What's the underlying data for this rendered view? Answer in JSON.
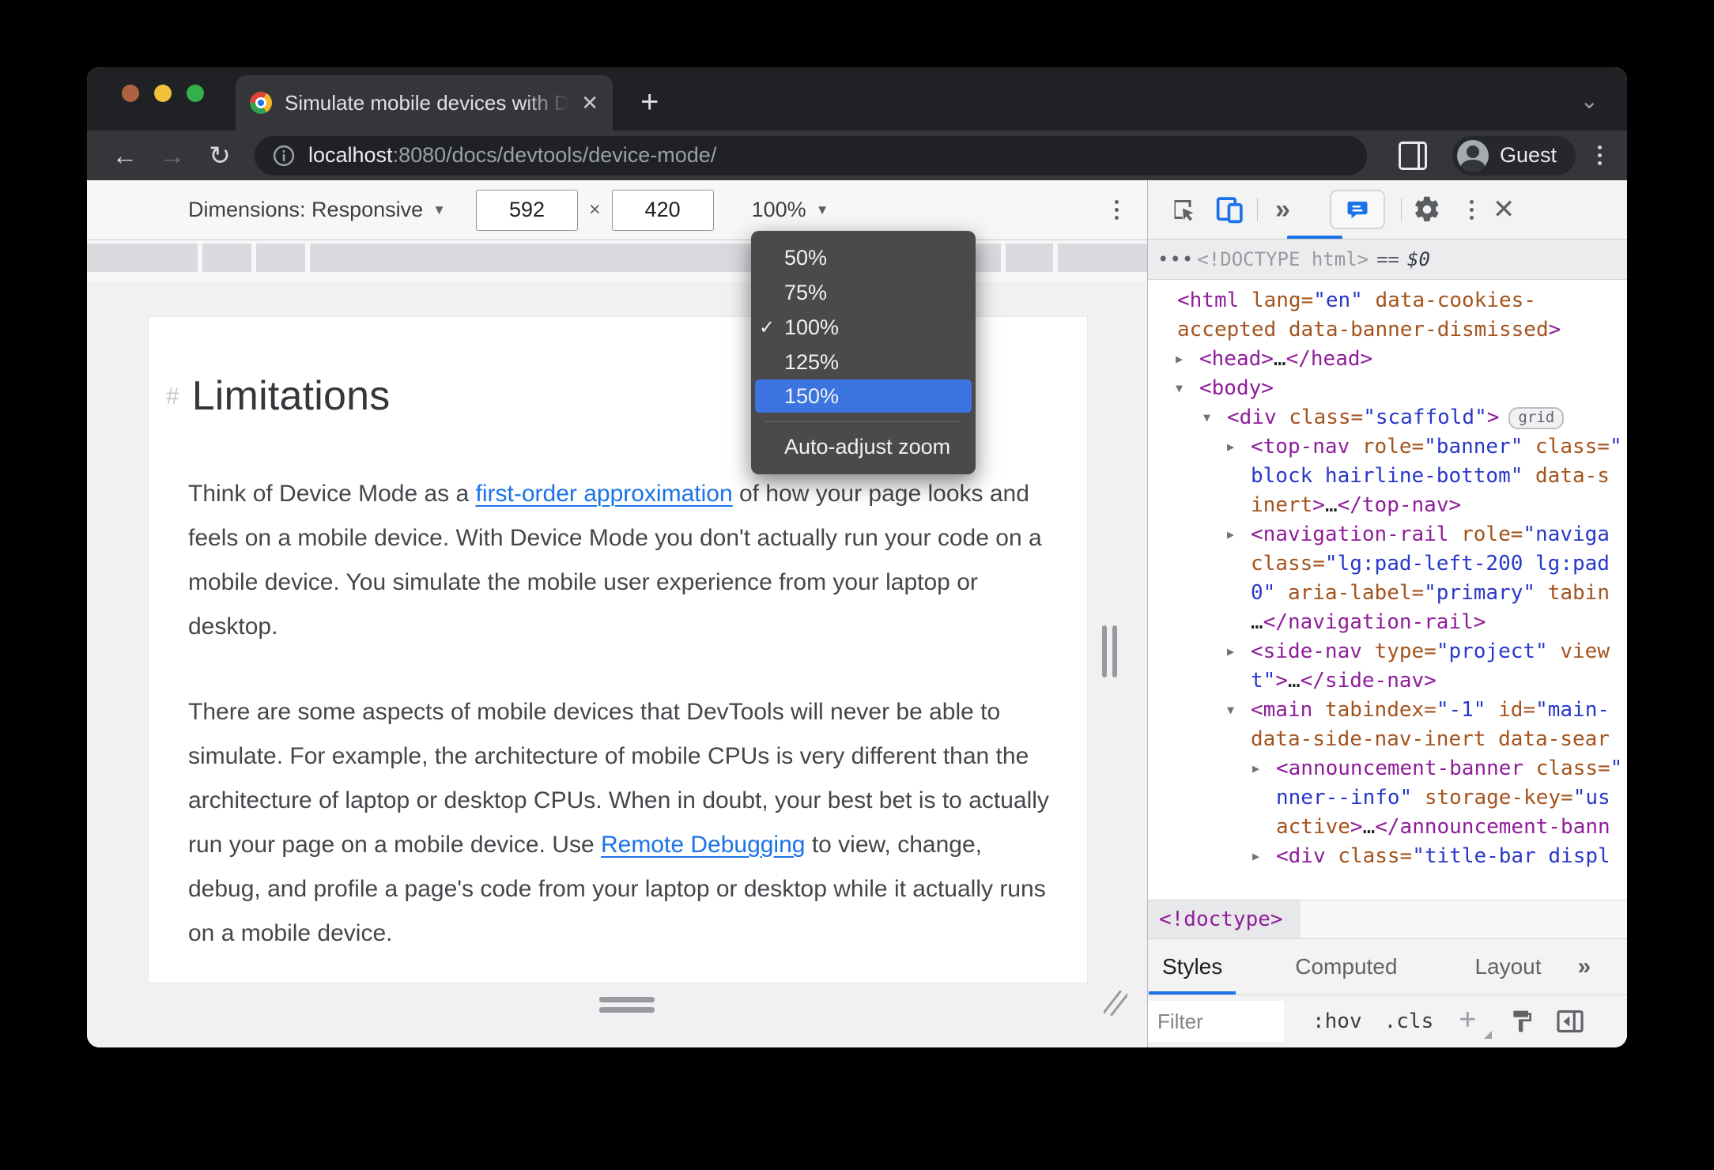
{
  "browser": {
    "tab_title": "Simulate mobile devices with D",
    "new_tab": "+",
    "tab_close": "✕",
    "tab_search_chevron": "⌄",
    "back": "←",
    "forward": "→",
    "reload": "↻",
    "url_host": "localhost",
    "url_path": ":8080/docs/devtools/device-mode/",
    "profile_label": "Guest"
  },
  "device_toolbar": {
    "dimensions_label": "Dimensions: Responsive",
    "caret": "▾",
    "width_value": "592",
    "times": "×",
    "height_value": "420",
    "zoom_value": "100%"
  },
  "zoom_menu": {
    "items": [
      {
        "label": "50%",
        "checked": false,
        "highlighted": false
      },
      {
        "label": "75%",
        "checked": false,
        "highlighted": false
      },
      {
        "label": "100%",
        "checked": true,
        "highlighted": false
      },
      {
        "label": "125%",
        "checked": false,
        "highlighted": false
      },
      {
        "label": "150%",
        "checked": false,
        "highlighted": true
      }
    ],
    "checkmark": "✓",
    "footer": "Auto-adjust zoom",
    "highlight_color": "#3b74e0"
  },
  "page": {
    "heading_hash": "#",
    "heading": "Limitations",
    "p1_before": "Think of Device Mode as a ",
    "p1_link": "first-order approximation",
    "p1_after": " of how your page looks and feels on a mobile device. With Device Mode you don't actually run your code on a mobile device. You simulate the mobile user experience from your laptop or desktop.",
    "p2_before": "There are some aspects of mobile devices that DevTools will never be able to simulate. For example, the architecture of mobile CPUs is very different than the architecture of laptop or desktop CPUs. When in doubt, your best bet is to actually run your page on a mobile device. Use ",
    "p2_link": "Remote Debugging",
    "p2_after": " to view, change, debug, and profile a page's code from your laptop or desktop while it actually runs on a mobile device.",
    "link_color": "#1a73e8"
  },
  "devtools": {
    "more_tabs": "»",
    "close": "✕",
    "breadcrumb": {
      "dots": "•••",
      "node": "<!DOCTYPE html>",
      "eq": "==",
      "dollar": "$0"
    },
    "tree": {
      "lines": [
        {
          "i": 37,
          "s": [
            [
              "tag",
              "<html"
            ],
            [
              "attr",
              " lang="
            ],
            [
              "val",
              "\"en\""
            ],
            [
              "attr",
              " data-cookies-"
            ]
          ]
        },
        {
          "i": 37,
          "s": [
            [
              "attr",
              "accepted data-banner-dismissed"
            ],
            [
              "tag",
              ">"
            ]
          ]
        },
        {
          "i": 65,
          "a": "c",
          "s": [
            [
              "tag",
              "<head>"
            ],
            [
              "plain",
              "…"
            ],
            [
              "tag",
              "</head>"
            ]
          ]
        },
        {
          "i": 65,
          "a": "o",
          "s": [
            [
              "tag",
              "<body>"
            ]
          ]
        },
        {
          "i": 100,
          "a": "o",
          "s": [
            [
              "tag",
              "<div"
            ],
            [
              "attr",
              " class="
            ],
            [
              "val",
              "\"scaffold\""
            ],
            [
              "tag",
              ">"
            ]
          ],
          "b": "grid"
        },
        {
          "i": 130,
          "a": "c",
          "s": [
            [
              "tag",
              "<top-nav"
            ],
            [
              "attr",
              " role="
            ],
            [
              "val",
              "\"banner\""
            ],
            [
              "attr",
              " class="
            ],
            [
              "val",
              "\""
            ]
          ]
        },
        {
          "i": 130,
          "s": [
            [
              "val",
              "block hairline-bottom\""
            ],
            [
              "attr",
              " data-s"
            ]
          ]
        },
        {
          "i": 130,
          "s": [
            [
              "attr",
              "inert"
            ],
            [
              "tag",
              ">"
            ],
            [
              "plain",
              "…"
            ],
            [
              "tag",
              "</top-nav>"
            ]
          ]
        },
        {
          "i": 130,
          "a": "c",
          "s": [
            [
              "tag",
              "<navigation-rail"
            ],
            [
              "attr",
              " role="
            ],
            [
              "val",
              "\"naviga"
            ]
          ]
        },
        {
          "i": 130,
          "s": [
            [
              "attr",
              "class="
            ],
            [
              "val",
              "\"lg:pad-left-200 lg:pad"
            ]
          ]
        },
        {
          "i": 130,
          "s": [
            [
              "val",
              "0\""
            ],
            [
              "attr",
              " aria-label="
            ],
            [
              "val",
              "\"primary\""
            ],
            [
              "attr",
              " tabin"
            ]
          ]
        },
        {
          "i": 130,
          "s": [
            [
              "plain",
              "…"
            ],
            [
              "tag",
              "</navigation-rail>"
            ]
          ]
        },
        {
          "i": 130,
          "a": "c",
          "s": [
            [
              "tag",
              "<side-nav"
            ],
            [
              "attr",
              " type="
            ],
            [
              "val",
              "\"project\""
            ],
            [
              "attr",
              " view"
            ]
          ]
        },
        {
          "i": 130,
          "s": [
            [
              "val",
              "t\""
            ],
            [
              "tag",
              ">"
            ],
            [
              "plain",
              "…"
            ],
            [
              "tag",
              "</side-nav>"
            ]
          ]
        },
        {
          "i": 130,
          "a": "o",
          "s": [
            [
              "tag",
              "<main"
            ],
            [
              "attr",
              " tabindex="
            ],
            [
              "val",
              "\"-1\""
            ],
            [
              "attr",
              " id="
            ],
            [
              "val",
              "\"main-"
            ]
          ]
        },
        {
          "i": 130,
          "s": [
            [
              "attr",
              "data-side-nav-inert data-sear"
            ]
          ]
        },
        {
          "i": 162,
          "a": "c",
          "s": [
            [
              "tag",
              "<announcement-banner"
            ],
            [
              "attr",
              " class="
            ],
            [
              "val",
              "\""
            ]
          ]
        },
        {
          "i": 162,
          "s": [
            [
              "val",
              "nner--info\""
            ],
            [
              "attr",
              " storage-key="
            ],
            [
              "val",
              "\"us"
            ]
          ]
        },
        {
          "i": 162,
          "s": [
            [
              "attr",
              "active"
            ],
            [
              "tag",
              ">"
            ],
            [
              "plain",
              "…"
            ],
            [
              "tag",
              "</announcement-bann"
            ]
          ]
        },
        {
          "i": 162,
          "a": "c",
          "s": [
            [
              "tag",
              "<div"
            ],
            [
              "attr",
              " class="
            ],
            [
              "val",
              "\"title-bar displ"
            ]
          ]
        }
      ]
    },
    "doctype_crumb": "<!doctype>",
    "tabs": [
      "Styles",
      "Computed",
      "Layout"
    ],
    "filter_placeholder": "Filter",
    "hov": ":hov",
    "cls": ".cls",
    "plus": "+",
    "colors": {
      "tag": "#8f1d9a",
      "attr_name": "#a4531c",
      "attr_value": "#2838c8",
      "accent_blue": "#1a73e8"
    }
  }
}
